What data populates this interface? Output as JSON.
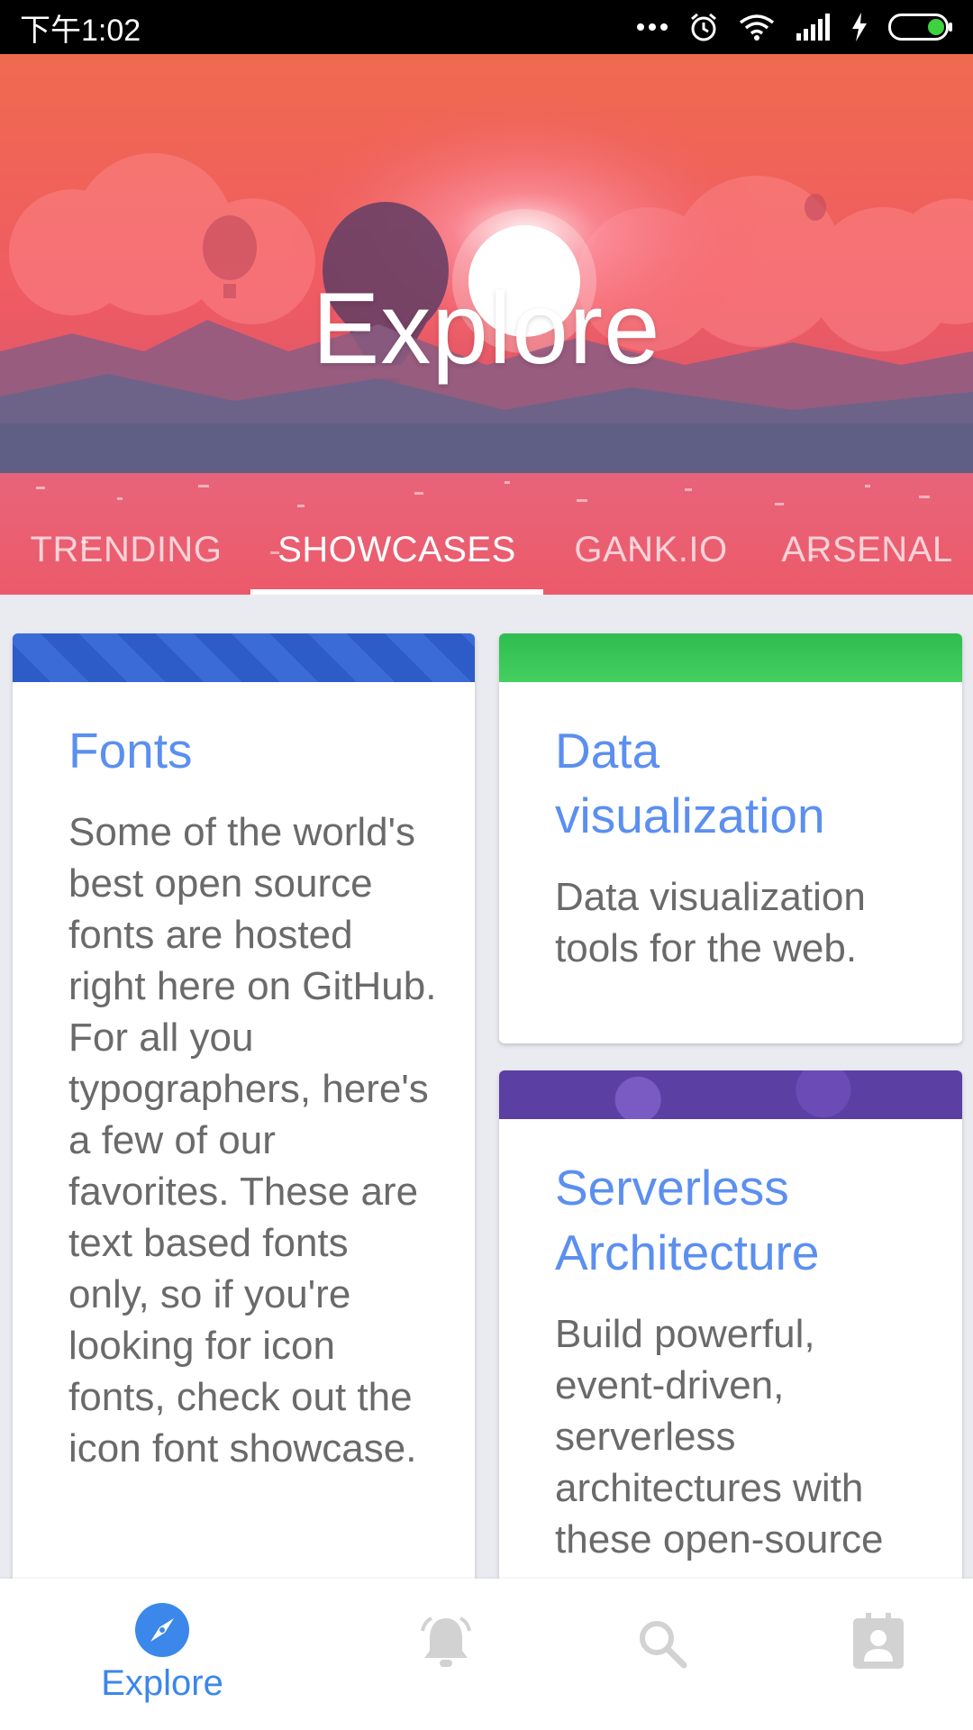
{
  "status_bar": {
    "time": "下午1:02",
    "icons": [
      "more-dots-icon",
      "alarm-icon",
      "wifi-icon",
      "signal-icon",
      "charging-icon",
      "battery-icon"
    ]
  },
  "header": {
    "title": "Explore",
    "tabs": [
      {
        "label": "TRENDING",
        "active": false
      },
      {
        "label": "SHOWCASES",
        "active": true
      },
      {
        "label": "GANK.IO",
        "active": false
      },
      {
        "label": "ARSENAL",
        "active": false
      }
    ]
  },
  "cards": [
    {
      "title": "Fonts",
      "description": "Some of the world's best open source fonts are hosted right here on GitHub. For all you typographers, here's a few of our favorites. These are text based fonts only, so if you're looking for icon fonts, check out the icon font showcase.",
      "banner_color": "#2f5fcc"
    },
    {
      "title": "Data visualization",
      "description": "Data visualization tools for the web.",
      "banner_color": "#35c255"
    },
    {
      "title": "Serverless Architecture",
      "description": "Build powerful, event-driven, serverless architectures with these open-source",
      "banner_color": "#5b3fa3"
    }
  ],
  "bottom_nav": {
    "items": [
      {
        "label": "Explore",
        "icon": "compass-icon",
        "active": true
      },
      {
        "label": "",
        "icon": "bell-icon",
        "active": false
      },
      {
        "label": "",
        "icon": "search-icon",
        "active": false
      },
      {
        "label": "",
        "icon": "profile-icon",
        "active": false
      }
    ]
  },
  "colors": {
    "accent": "#3b87ea",
    "card_title": "#5b8ff0",
    "inactive_icon": "#cfcfcf"
  }
}
